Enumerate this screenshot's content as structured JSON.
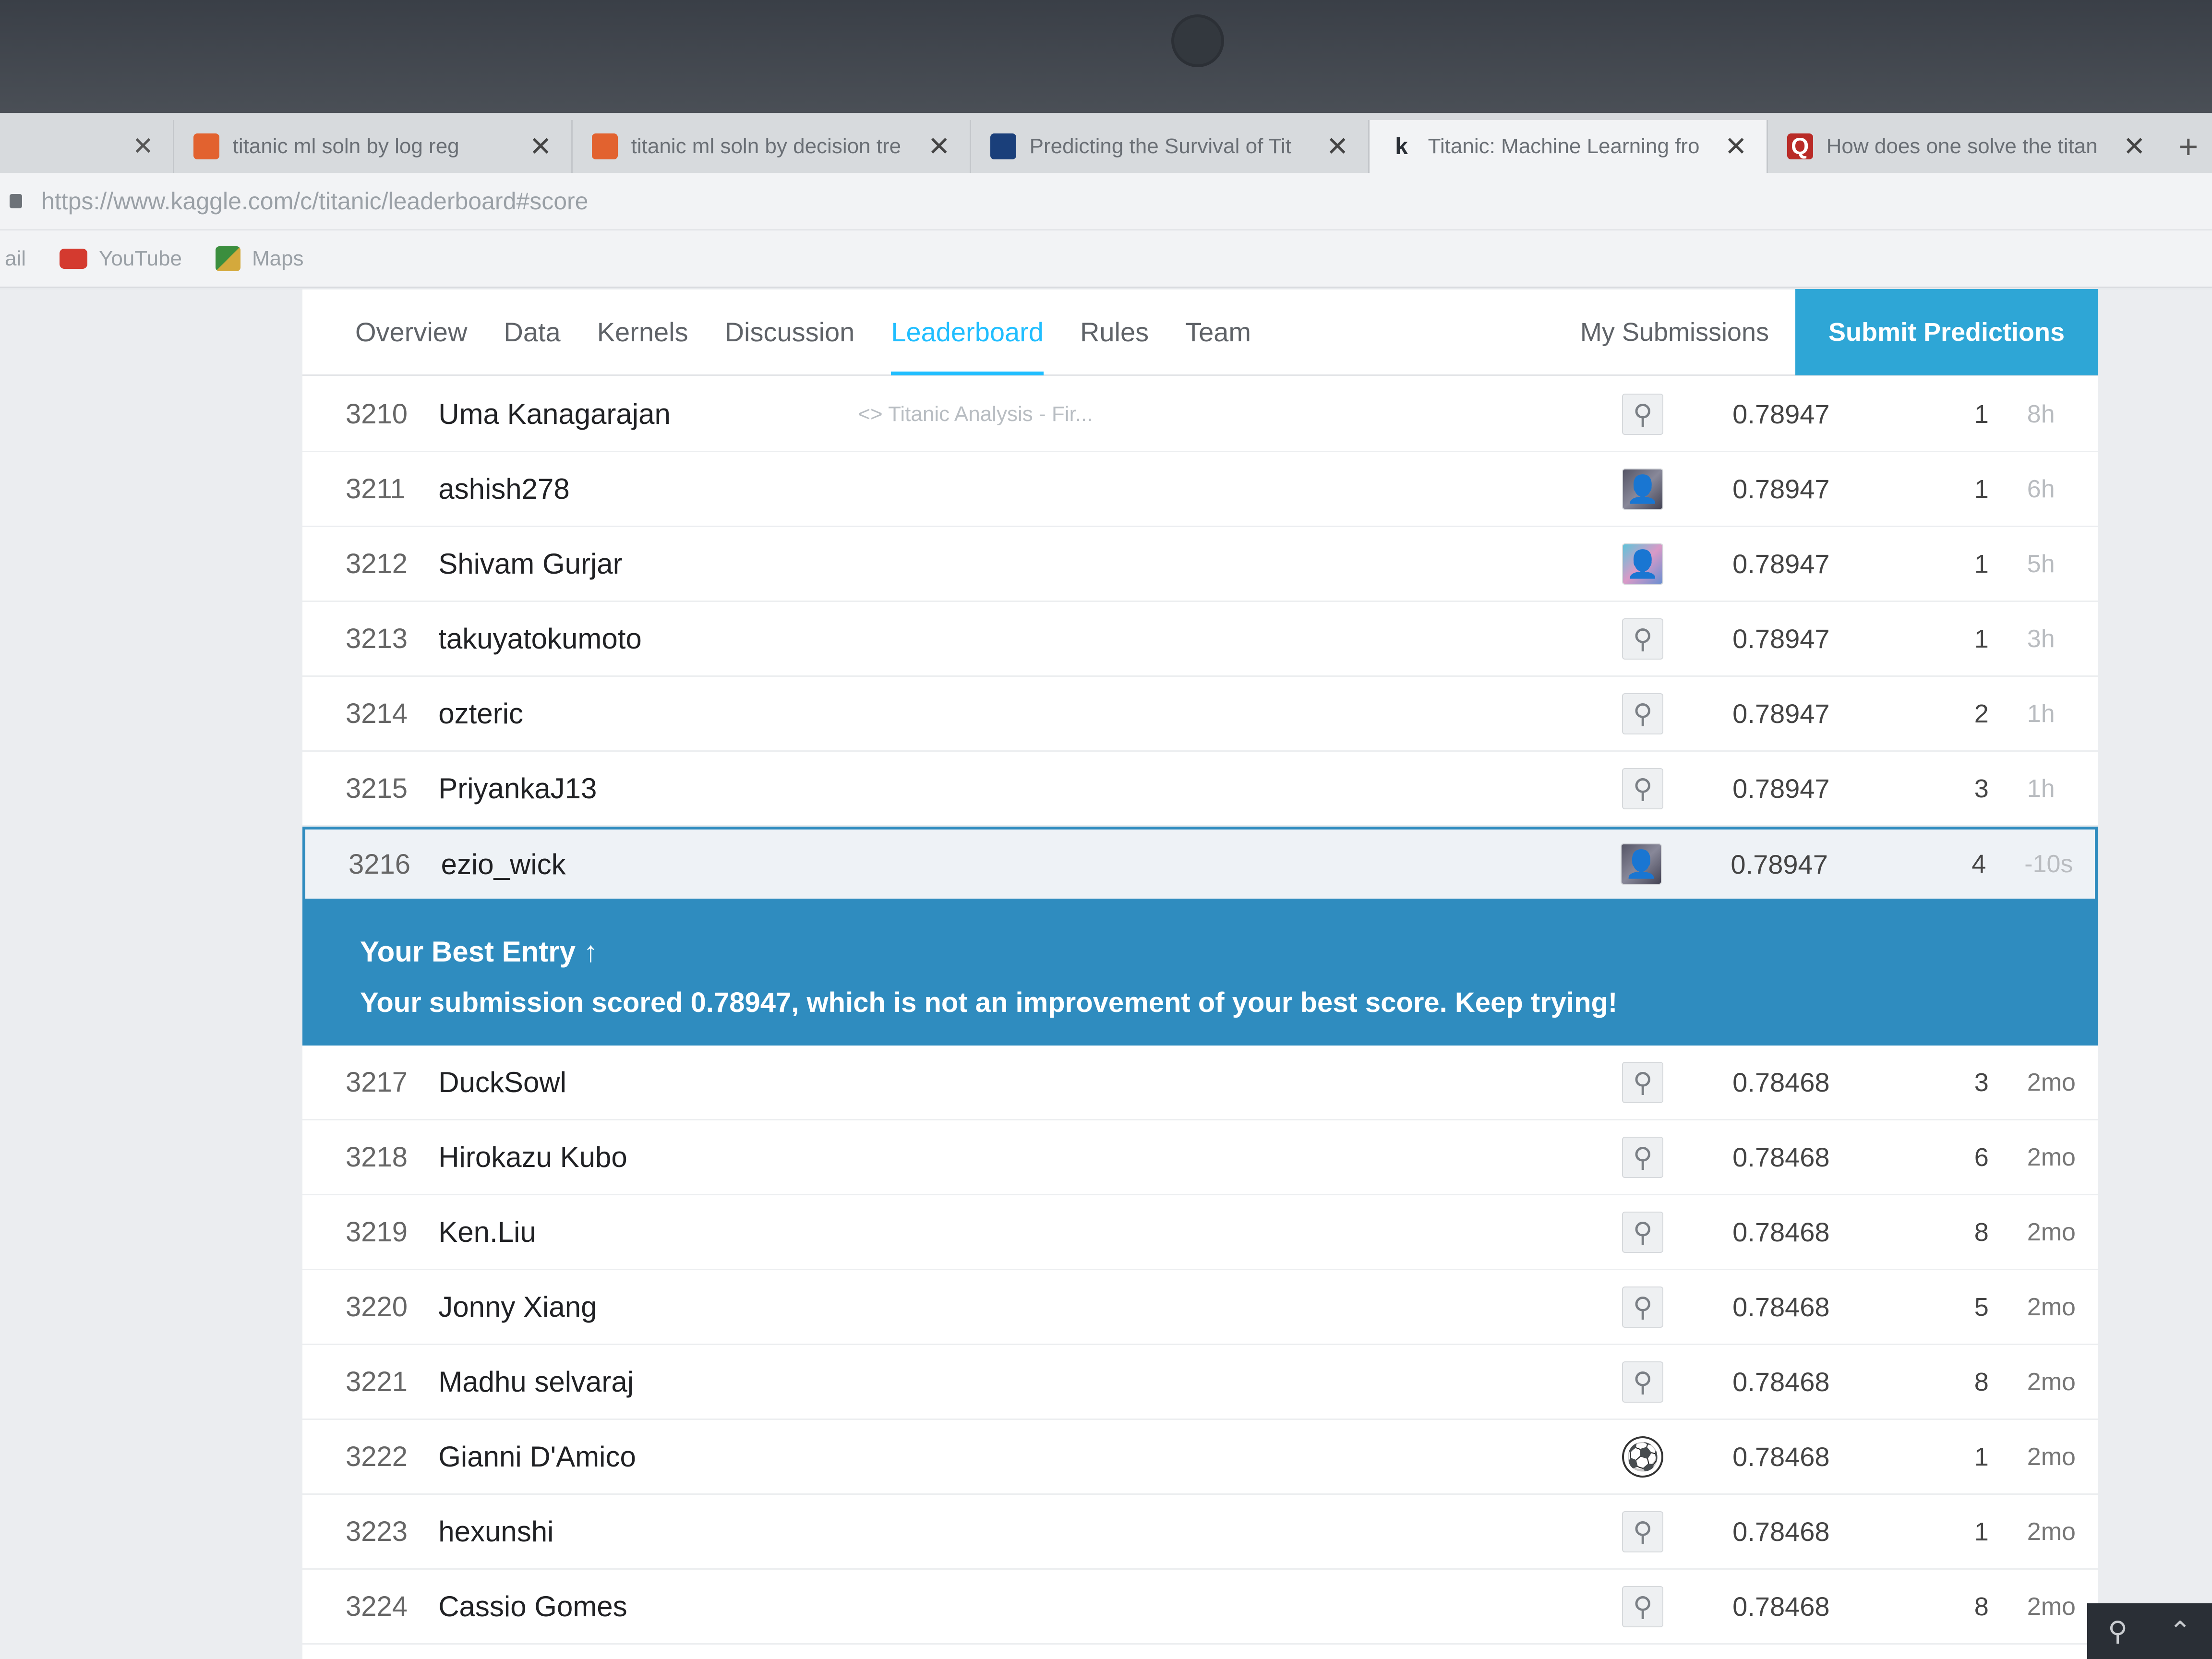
{
  "tabs": [
    {
      "title": "titanic ml soln by log reg",
      "favicon": "doc-orange-icon",
      "color": "#e2622f"
    },
    {
      "title": "titanic ml soln by decision tre",
      "favicon": "doc-orange-icon",
      "color": "#e2622f"
    },
    {
      "title": "Predicting the Survival of Tit",
      "favicon": "doc-blue-icon",
      "color": "#1a3f7a"
    },
    {
      "title": "Titanic: Machine Learning fro",
      "favicon": "kaggle-k-icon",
      "color": "#2a2f36",
      "active": true
    },
    {
      "title": "How does one solve the titan",
      "favicon": "quora-q-icon",
      "color": "#b92b27"
    }
  ],
  "url": "https://www.kaggle.com/c/titanic/leaderboard#score",
  "bookmarks": [
    {
      "label": "ail"
    },
    {
      "label": "YouTube"
    },
    {
      "label": "Maps"
    }
  ],
  "nav": {
    "items": [
      "Overview",
      "Data",
      "Kernels",
      "Discussion",
      "Leaderboard",
      "Rules",
      "Team"
    ],
    "active": "Leaderboard",
    "my_submissions": "My Submissions",
    "submit": "Submit Predictions"
  },
  "rows_top": [
    {
      "rank": "3210",
      "name": "Uma Kanagarajan",
      "kernel": "<> Titanic Analysis - Fir...",
      "avatar": "default",
      "score": "0.78947",
      "entries": "1",
      "last": "8h"
    },
    {
      "rank": "3211",
      "name": "ashish278",
      "kernel": "",
      "avatar": "photo",
      "score": "0.78947",
      "entries": "1",
      "last": "6h"
    },
    {
      "rank": "3212",
      "name": "Shivam Gurjar",
      "kernel": "",
      "avatar": "color",
      "score": "0.78947",
      "entries": "1",
      "last": "5h"
    },
    {
      "rank": "3213",
      "name": "takuyatokumoto",
      "kernel": "",
      "avatar": "default",
      "score": "0.78947",
      "entries": "1",
      "last": "3h"
    },
    {
      "rank": "3214",
      "name": "ozteric",
      "kernel": "",
      "avatar": "default",
      "score": "0.78947",
      "entries": "2",
      "last": "1h"
    },
    {
      "rank": "3215",
      "name": "PriyankaJ13",
      "kernel": "",
      "avatar": "default",
      "score": "0.78947",
      "entries": "3",
      "last": "1h"
    }
  ],
  "highlight_row": {
    "rank": "3216",
    "name": "ezio_wick",
    "avatar": "photo",
    "score": "0.78947",
    "entries": "4",
    "last": "-10s"
  },
  "banner": {
    "title": "Your Best Entry ↑",
    "message": "Your submission scored 0.78947, which is not an improvement of your best score. Keep trying!"
  },
  "rows_bottom": [
    {
      "rank": "3217",
      "name": "DuckSowl",
      "avatar": "default",
      "score": "0.78468",
      "entries": "3",
      "last": "2mo"
    },
    {
      "rank": "3218",
      "name": "Hirokazu Kubo",
      "avatar": "default",
      "score": "0.78468",
      "entries": "6",
      "last": "2mo"
    },
    {
      "rank": "3219",
      "name": "Ken.Liu",
      "avatar": "default",
      "score": "0.78468",
      "entries": "8",
      "last": "2mo"
    },
    {
      "rank": "3220",
      "name": "Jonny Xiang",
      "avatar": "default",
      "score": "0.78468",
      "entries": "5",
      "last": "2mo"
    },
    {
      "rank": "3221",
      "name": "Madhu selvaraj",
      "avatar": "default",
      "score": "0.78468",
      "entries": "8",
      "last": "2mo"
    },
    {
      "rank": "3222",
      "name": "Gianni D'Amico",
      "avatar": "ball",
      "score": "0.78468",
      "entries": "1",
      "last": "2mo"
    },
    {
      "rank": "3223",
      "name": "hexunshi",
      "avatar": "default",
      "score": "0.78468",
      "entries": "1",
      "last": "2mo"
    },
    {
      "rank": "3224",
      "name": "Cassio Gomes",
      "avatar": "default",
      "score": "0.78468",
      "entries": "8",
      "last": "2mo"
    }
  ]
}
